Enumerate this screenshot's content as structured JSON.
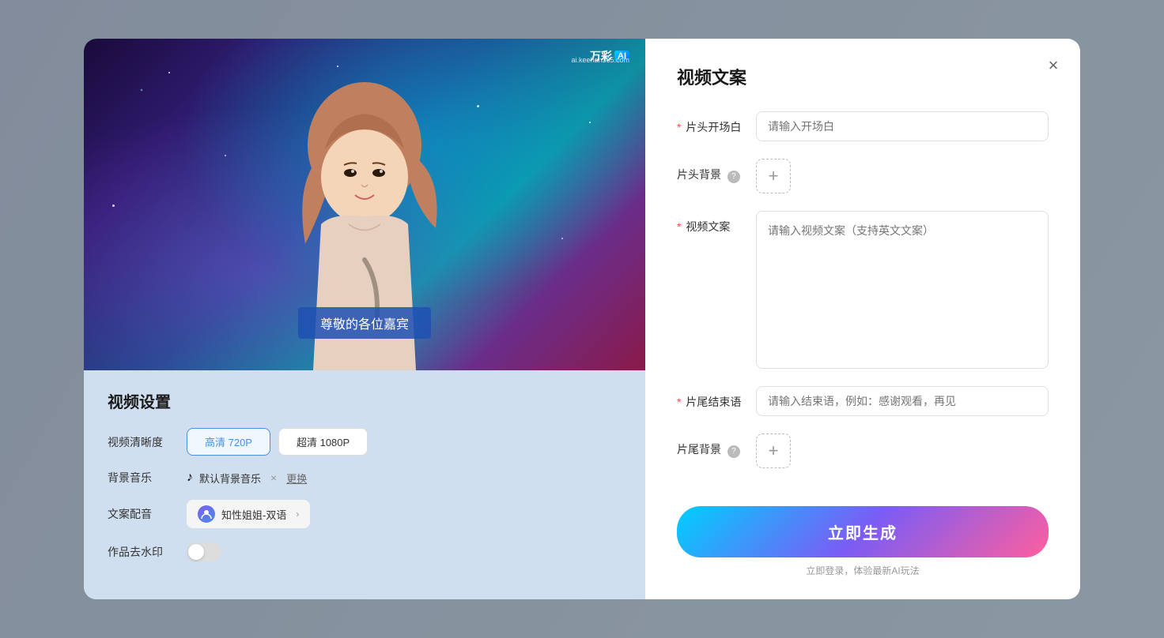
{
  "modal": {
    "close_label": "×",
    "left": {
      "video_subtitle": "尊敬的各位嘉宾",
      "watermark_brand": "万彩",
      "watermark_ai": "AI",
      "watermark_url": "ai.keehan365.com",
      "settings_title": "视频设置",
      "quality_label": "视频清晰度",
      "quality_options": [
        {
          "label": "高清 720P",
          "active": true
        },
        {
          "label": "超清 1080P",
          "active": false
        }
      ],
      "music_label": "背景音乐",
      "music_note": "♪",
      "music_name": "默认背景音乐",
      "music_change": "更换",
      "voice_label": "文案配音",
      "voice_name": "知性姐姐-双语",
      "watermark_label": "作品去水印"
    },
    "right": {
      "title": "视频文案",
      "fields": {
        "opening_label": "片头开场白",
        "opening_required": true,
        "opening_placeholder": "请输入开场白",
        "header_bg_label": "片头背景",
        "header_bg_has_help": true,
        "copy_label": "视频文案",
        "copy_required": true,
        "copy_placeholder": "请输入视频文案（支持英文文案）",
        "ending_label": "片尾结束语",
        "ending_required": true,
        "ending_placeholder": "请输入结束语，例如：感谢观看，再见",
        "footer_bg_label": "片尾背景",
        "footer_bg_has_help": true
      },
      "generate_btn": "立即生成",
      "generate_hint": "立即登录，体验最新AI玩法"
    }
  }
}
